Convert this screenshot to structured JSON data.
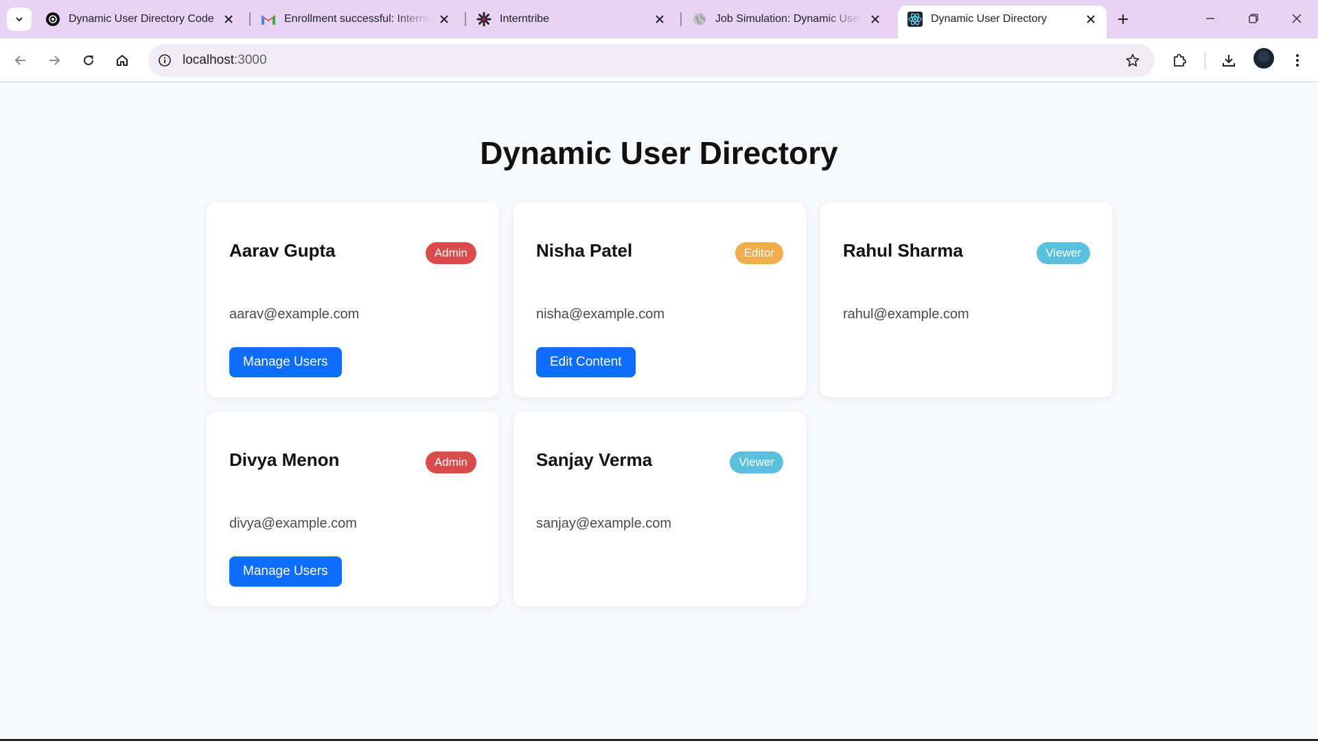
{
  "browser": {
    "tabs": [
      {
        "title": "Dynamic User Directory Code",
        "icon": "chatgpt-icon"
      },
      {
        "title": "Enrollment successful: Interntribe",
        "icon": "gmail-icon"
      },
      {
        "title": "Interntribe",
        "icon": "interntribe-icon"
      },
      {
        "title": "Job Simulation: Dynamic User Directory",
        "icon": "globe-icon"
      },
      {
        "title": "Dynamic User Directory",
        "icon": "react-icon"
      }
    ],
    "active_tab_index": 4,
    "url": {
      "host": "localhost",
      "port": ":3000"
    }
  },
  "page": {
    "title": "Dynamic User Directory"
  },
  "users": [
    {
      "name": "Aarav Gupta",
      "role": "Admin",
      "email": "aarav@example.com",
      "action": "Manage Users"
    },
    {
      "name": "Nisha Patel",
      "role": "Editor",
      "email": "nisha@example.com",
      "action": "Edit Content"
    },
    {
      "name": "Rahul Sharma",
      "role": "Viewer",
      "email": "rahul@example.com",
      "action": ""
    },
    {
      "name": "Divya Menon",
      "role": "Admin",
      "email": "divya@example.com",
      "action": "Manage Users"
    },
    {
      "name": "Sanjay Verma",
      "role": "Viewer",
      "email": "sanjay@example.com",
      "action": ""
    }
  ],
  "colors": {
    "admin": "#dc4b4b",
    "editor": "#f0ad4e",
    "viewer": "#5bc0de",
    "primary": "#0d6efd",
    "tabbar": "#e8d3f5"
  }
}
